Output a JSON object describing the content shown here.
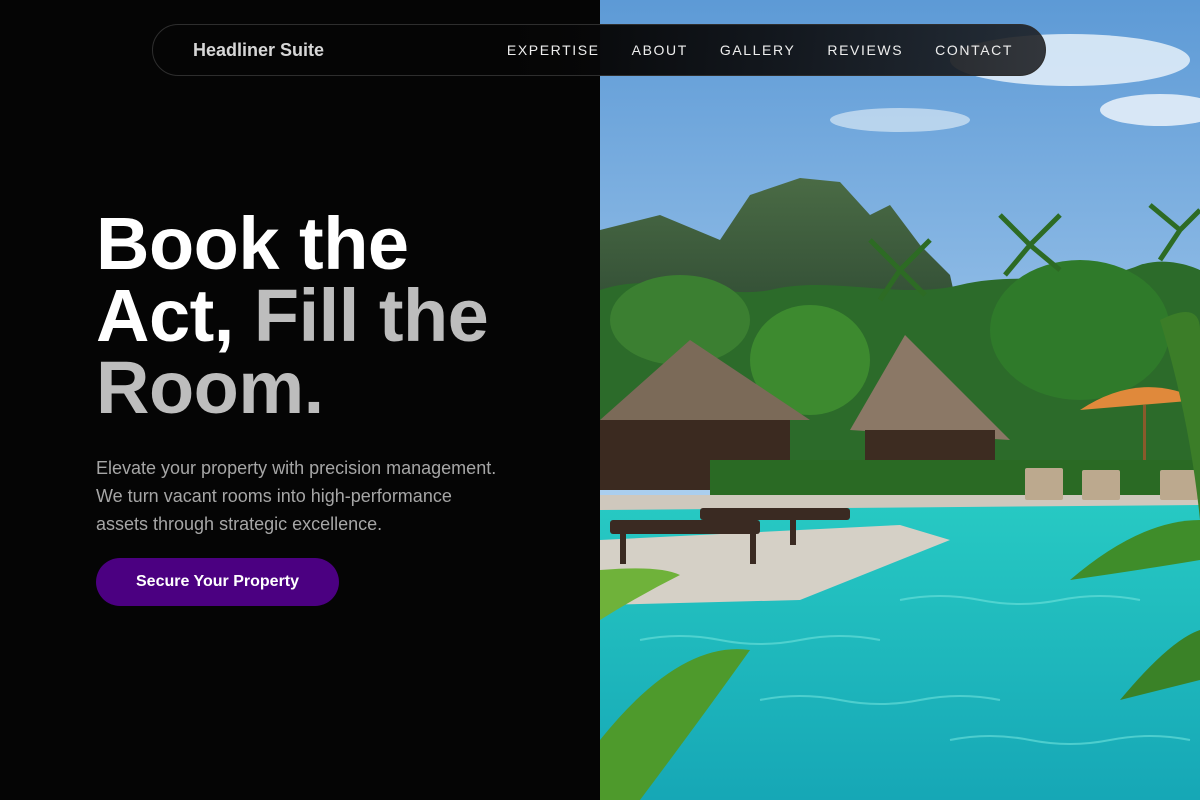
{
  "nav": {
    "brand": "Headliner Suite",
    "links": [
      "EXPERTISE",
      "ABOUT",
      "GALLERY",
      "REVIEWS",
      "CONTACT"
    ]
  },
  "hero": {
    "headline_line1": "Book the",
    "headline_line2_white": "Act,",
    "headline_line2_muted": "Fill the",
    "headline_line3": "Room.",
    "subtext": "Elevate your property with precision management. We turn vacant rooms into high-performance assets through strategic excellence.",
    "cta_label": "Secure Your Property"
  },
  "colors": {
    "background": "#050505",
    "accent": "#4b0081",
    "headline_muted": "#bdbdbd"
  },
  "image": {
    "subject": "tropical-resort-pool-with-thatched-villas-and-limestone-mountain"
  }
}
